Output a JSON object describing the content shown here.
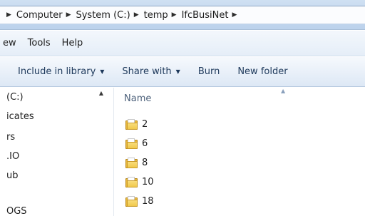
{
  "breadcrumb": {
    "items": [
      "Computer",
      "System (C:)",
      "temp",
      "IfcBusiNet"
    ]
  },
  "menu": {
    "items": [
      "ew",
      "Tools",
      "Help"
    ]
  },
  "toolbar": {
    "include_label": "Include in library",
    "share_label": "Share with",
    "burn_label": "Burn",
    "new_folder_label": "New folder"
  },
  "nav": {
    "items": [
      "(C:)",
      "icates",
      "rs",
      ".IO",
      "ub",
      "OGS"
    ]
  },
  "content": {
    "name_header": "Name",
    "files": [
      "2",
      "6",
      "8",
      "10",
      "18"
    ]
  }
}
